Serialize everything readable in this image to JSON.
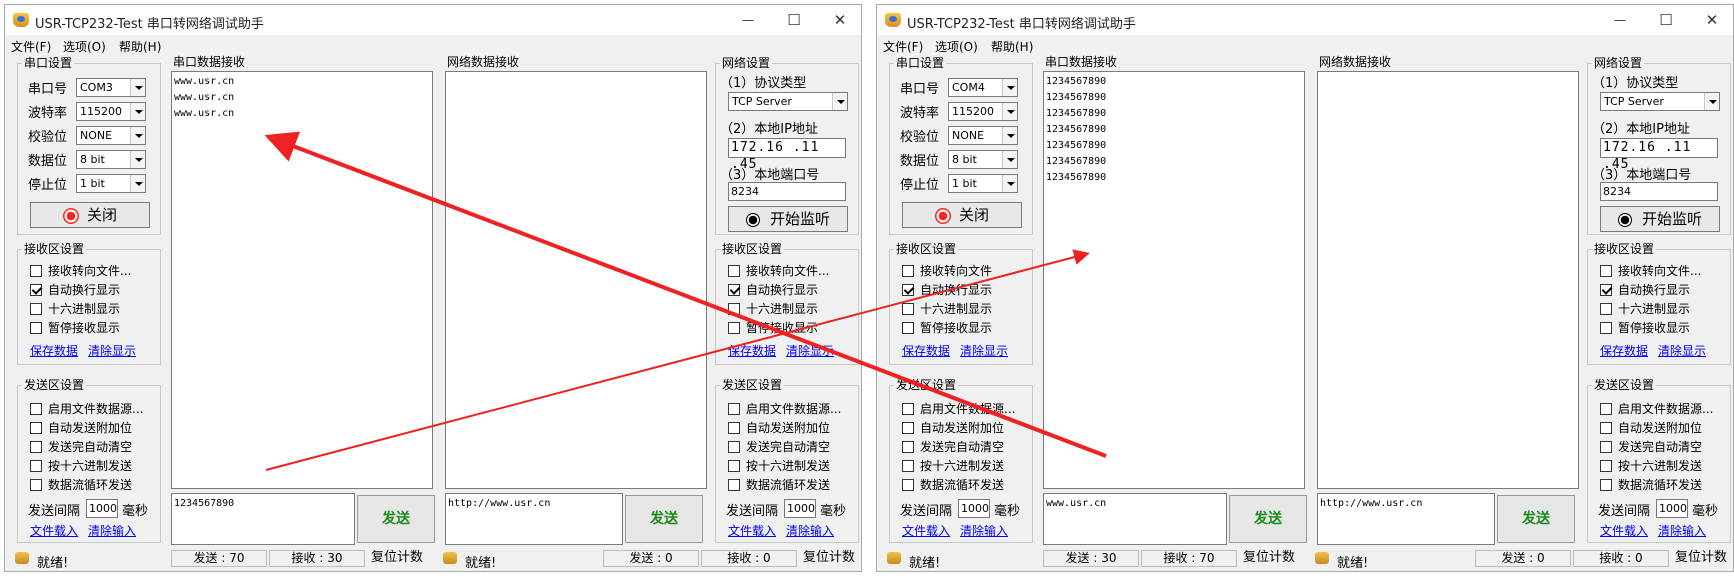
{
  "windows": [
    {
      "title": "USR-TCP232-Test 串口转网络调试助手",
      "menu": [
        "文件(F)",
        "选项(O)",
        "帮助(H)"
      ],
      "serial_settings": {
        "title": "串口设置",
        "port_label": "串口号",
        "port_value": "COM3",
        "baud_label": "波特率",
        "baud_value": "115200",
        "parity_label": "校验位",
        "parity_value": "NONE",
        "databits_label": "数据位",
        "databits_value": "8 bit",
        "stopbits_label": "停止位",
        "stopbits_value": "1 bit",
        "open_button": "关闭"
      },
      "recv_settings": {
        "title": "接收区设置",
        "options": [
          {
            "label": "接收转向文件...",
            "checked": false
          },
          {
            "label": "自动换行显示",
            "checked": true
          },
          {
            "label": "十六进制显示",
            "checked": false
          },
          {
            "label": "暂停接收显示",
            "checked": false
          }
        ],
        "save_link": "保存数据",
        "clear_link": "清除显示"
      },
      "send_settings": {
        "title": "发送区设置",
        "options": [
          {
            "label": "启用文件数据源...",
            "checked": false
          },
          {
            "label": "自动发送附加位",
            "checked": false
          },
          {
            "label": "发送完自动清空",
            "checked": false
          },
          {
            "label": "按十六进制发送",
            "checked": false
          },
          {
            "label": "数据流循环发送",
            "checked": false
          }
        ],
        "interval_label": "发送间隔",
        "interval_value": "1000",
        "interval_unit": "毫秒",
        "load_link": "文件载入",
        "clear_link": "清除输入"
      },
      "serial_recv": {
        "title": "串口数据接收",
        "lines": [
          "www.usr.cn",
          "www.usr.cn",
          "www.usr.cn"
        ],
        "send_text": "1234567890",
        "send_button": "发送"
      },
      "net_recv": {
        "title": "网络数据接收",
        "lines": [],
        "send_text": "http://www.usr.cn",
        "send_button": "发送"
      },
      "net_settings": {
        "title": "网络设置",
        "protocol_label": "（1）协议类型",
        "protocol_value": "TCP Server",
        "ip_label": "（2）本地IP地址",
        "ip_value": "172.16 .11 .45",
        "port_label": "（3）本地端口号",
        "port_value": "8234",
        "listen_button": "开始监听"
      },
      "net_recv_settings": {
        "title": "接收区设置",
        "options": [
          {
            "label": "接收转向文件...",
            "checked": false
          },
          {
            "label": "自动换行显示",
            "checked": true
          },
          {
            "label": "十六进制显示",
            "checked": false
          },
          {
            "label": "暂停接收显示",
            "checked": false
          }
        ],
        "save_link": "保存数据",
        "clear_link": "清除显示"
      },
      "net_send_settings": {
        "title": "发送区设置",
        "options": [
          {
            "label": "启用文件数据源...",
            "checked": false
          },
          {
            "label": "自动发送附加位",
            "checked": false
          },
          {
            "label": "发送完自动清空",
            "checked": false
          },
          {
            "label": "按十六进制发送",
            "checked": false
          },
          {
            "label": "数据流循环发送",
            "checked": false
          }
        ],
        "interval_label": "发送间隔",
        "interval_value": "1000",
        "interval_unit": "毫秒",
        "load_link": "文件载入",
        "clear_link": "清除输入"
      },
      "status": {
        "ready": "就绪!",
        "serial_sent": "发送 : 70",
        "serial_recv": "接收 : 30",
        "reset1": "复位计数",
        "ready2": "就绪!",
        "net_sent": "发送 : 0",
        "net_recv": "接收 : 0",
        "reset2": "复位计数"
      }
    },
    {
      "title": "USR-TCP232-Test 串口转网络调试助手",
      "menu": [
        "文件(F)",
        "选项(O)",
        "帮助(H)"
      ],
      "serial_settings": {
        "title": "串口设置",
        "port_label": "串口号",
        "port_value": "COM4",
        "baud_label": "波特率",
        "baud_value": "115200",
        "parity_label": "校验位",
        "parity_value": "NONE",
        "databits_label": "数据位",
        "databits_value": "8 bit",
        "stopbits_label": "停止位",
        "stopbits_value": "1 bit",
        "open_button": "关闭"
      },
      "recv_settings": {
        "title": "接收区设置",
        "options": [
          {
            "label": "接收转向文件",
            "checked": false
          },
          {
            "label": "自动换行显示",
            "checked": true
          },
          {
            "label": "十六进制显示",
            "checked": false
          },
          {
            "label": "暂停接收显示",
            "checked": false
          }
        ],
        "save_link": "保存数据",
        "clear_link": "清除显示"
      },
      "send_settings": {
        "title": "发送区设置",
        "options": [
          {
            "label": "启用文件数据源...",
            "checked": false
          },
          {
            "label": "自动发送附加位",
            "checked": false
          },
          {
            "label": "发送完自动清空",
            "checked": false
          },
          {
            "label": "按十六进制发送",
            "checked": false
          },
          {
            "label": "数据流循环发送",
            "checked": false
          }
        ],
        "interval_label": "发送间隔",
        "interval_value": "1000",
        "interval_unit": "毫秒",
        "load_link": "文件载入",
        "clear_link": "清除输入"
      },
      "serial_recv": {
        "title": "串口数据接收",
        "lines": [
          "1234567890",
          "1234567890",
          "1234567890",
          "1234567890",
          "1234567890",
          "1234567890",
          "1234567890"
        ],
        "send_text": "www.usr.cn",
        "send_button": "发送"
      },
      "net_recv": {
        "title": "网络数据接收",
        "lines": [],
        "send_text": "http://www.usr.cn",
        "send_button": "发送"
      },
      "net_settings": {
        "title": "网络设置",
        "protocol_label": "（1）协议类型",
        "protocol_value": "TCP Server",
        "ip_label": "（2）本地IP地址",
        "ip_value": "172.16 .11 .45",
        "port_label": "（3）本地端口号",
        "port_value": "8234",
        "listen_button": "开始监听"
      },
      "net_recv_settings": {
        "title": "接收区设置",
        "options": [
          {
            "label": "接收转向文件...",
            "checked": false
          },
          {
            "label": "自动换行显示",
            "checked": true
          },
          {
            "label": "十六进制显示",
            "checked": false
          },
          {
            "label": "暂停接收显示",
            "checked": false
          }
        ],
        "save_link": "保存数据",
        "clear_link": "清除显示"
      },
      "net_send_settings": {
        "title": "发送区设置",
        "options": [
          {
            "label": "启用文件数据源...",
            "checked": false
          },
          {
            "label": "自动发送附加位",
            "checked": false
          },
          {
            "label": "发送完自动清空",
            "checked": false
          },
          {
            "label": "按十六进制发送",
            "checked": false
          },
          {
            "label": "数据流循环发送",
            "checked": false
          }
        ],
        "interval_label": "发送间隔",
        "interval_value": "1000",
        "interval_unit": "毫秒",
        "load_link": "文件载入",
        "clear_link": "清除输入"
      },
      "status": {
        "ready": "就绪!",
        "serial_sent": "发送 : 30",
        "serial_recv": "接收 : 70",
        "reset1": "复位计数",
        "ready2": "就绪!",
        "net_sent": "发送 : 0",
        "net_recv": "接收 : 0",
        "reset2": "复位计数"
      }
    }
  ],
  "annotation_colors": {
    "arrow": "#ee2222"
  }
}
